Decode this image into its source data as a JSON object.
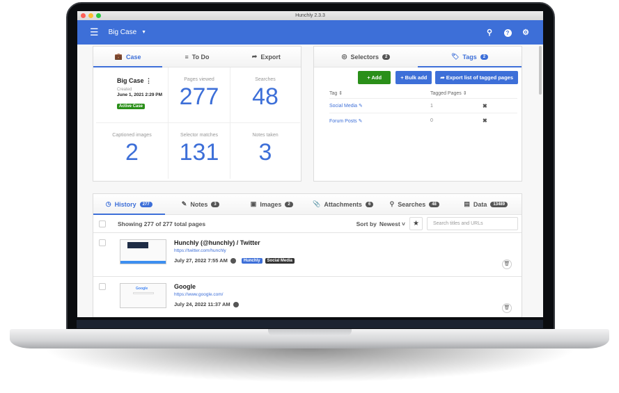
{
  "window": {
    "title": "Hunchly 2.3.3"
  },
  "appbar": {
    "case_name": "Big Case",
    "icons": [
      "menu-icon",
      "search-icon",
      "help-icon",
      "gear-icon"
    ]
  },
  "case_panel": {
    "tabs": [
      {
        "label": "Case",
        "icon": "briefcase-icon",
        "active": true
      },
      {
        "label": "To Do",
        "icon": "list-icon",
        "active": false
      },
      {
        "label": "Export",
        "icon": "share-icon",
        "active": false
      }
    ],
    "case": {
      "name": "Big Case",
      "created_label": "Created",
      "created_date": "June 1, 2021 2:29 PM",
      "status": "Active Case"
    },
    "stats": [
      {
        "label": "Pages viewed",
        "value": "277"
      },
      {
        "label": "Searches",
        "value": "48"
      },
      {
        "label": "Captioned images",
        "value": "2"
      },
      {
        "label": "Selector matches",
        "value": "131"
      },
      {
        "label": "Notes taken",
        "value": "3"
      }
    ]
  },
  "tags_panel": {
    "tabs": [
      {
        "label": "Selectors",
        "count": "2",
        "icon": "target-icon",
        "active": false
      },
      {
        "label": "Tags",
        "count": "2",
        "icon": "tags-icon",
        "active": true
      }
    ],
    "buttons": {
      "add": "+ Add",
      "bulk_add": "+ Bulk add",
      "export": "Export list of tagged pages"
    },
    "columns": {
      "tag": "Tag",
      "tagged_pages": "Tagged Pages"
    },
    "rows": [
      {
        "tag": "Social Media",
        "count": "1"
      },
      {
        "tag": "Forum Posts",
        "count": "0"
      }
    ]
  },
  "history_panel": {
    "tabs": [
      {
        "label": "History",
        "count": "277",
        "active": true
      },
      {
        "label": "Notes",
        "count": "3"
      },
      {
        "label": "Images",
        "count": "2"
      },
      {
        "label": "Attachments",
        "count": "6"
      },
      {
        "label": "Searches",
        "count": "48"
      },
      {
        "label": "Data",
        "count": "13489"
      }
    ],
    "showing": "Showing 277 of 277 total pages",
    "sort_label": "Sort by",
    "sort_value": "Newest",
    "search_placeholder": "Search titles and URLs",
    "rows": [
      {
        "title": "Hunchly (@hunchly) / Twitter",
        "url": "https://twitter.com/hunchly",
        "date": "July 27, 2022 7:55 AM",
        "tags": [
          "Hunchly",
          "Social Media"
        ]
      },
      {
        "title": "Google",
        "url": "https://www.google.com/",
        "date": "July 24, 2022 11:37 AM",
        "tags": []
      }
    ]
  }
}
